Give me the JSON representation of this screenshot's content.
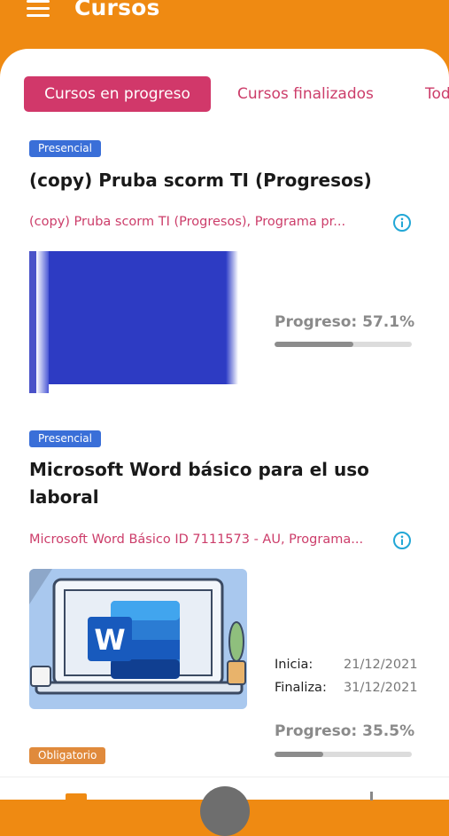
{
  "header": {
    "title": "Cursos",
    "menu_icon": "menu-icon"
  },
  "tabs": [
    {
      "label": "Cursos en progreso",
      "active": true
    },
    {
      "label": "Cursos finalizados",
      "active": false
    },
    {
      "label": "Tod",
      "active": false
    }
  ],
  "courses": [
    {
      "badge": "Presencial",
      "title": "(copy)  Pruba scorm TI (Progresos)",
      "subtitle": "(copy) Pruba scorm TI (Progresos), Programa pr...",
      "info_icon": "info-circle-icon",
      "progress_label": "Progreso: 57.1%",
      "progress": 0.571
    },
    {
      "badge": "Presencial",
      "title": "Microsoft Word básico para el uso laboral",
      "subtitle": "Microsoft Word Básico ID 7111573 - AU, Programa...",
      "info_icon": "info-circle-icon",
      "start_label": "Inicia:",
      "start_date": "21/12/2021",
      "end_label": "Finaliza:",
      "end_date": "31/12/2021",
      "progress_label": "Progreso: 35.5%",
      "progress": 0.355
    },
    {
      "badge": "Obligatorio"
    }
  ],
  "colors": {
    "header_orange": "#ef8a12",
    "accent_pink": "#d1386a",
    "badge_blue": "#3a6fd8",
    "badge_orange": "#e08a3c",
    "info_cyan": "#22a7d6"
  },
  "bottom_nav": {
    "icons": [
      "folder-icon",
      "center-action-icon",
      "more-icon"
    ]
  }
}
